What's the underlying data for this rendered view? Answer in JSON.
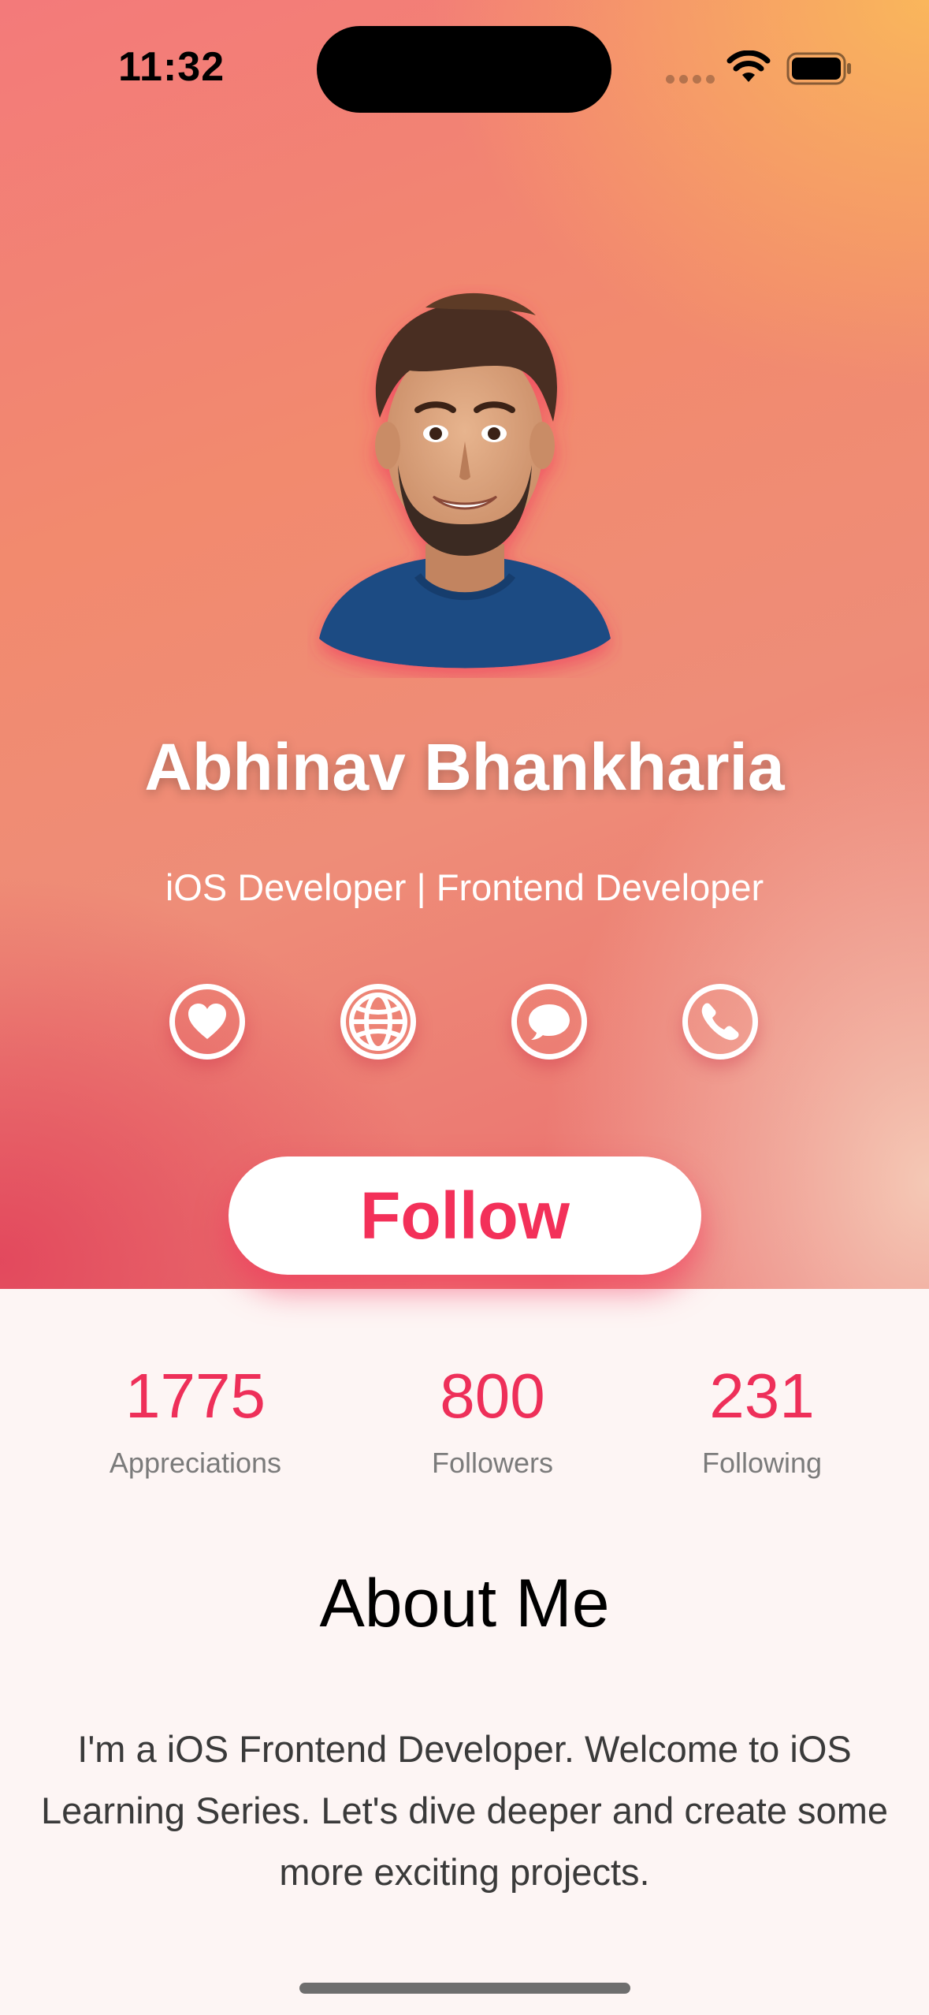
{
  "status_bar": {
    "time": "11:32"
  },
  "profile": {
    "name": "Abhinav Bhankharia",
    "title": "iOS Developer | Frontend Developer",
    "social_icons": [
      "heart-icon",
      "globe-icon",
      "message-icon",
      "phone-icon"
    ]
  },
  "follow_button": {
    "label": "Follow"
  },
  "stats": [
    {
      "value": "1775",
      "label": "Appreciations"
    },
    {
      "value": "800",
      "label": "Followers"
    },
    {
      "value": "231",
      "label": "Following"
    }
  ],
  "about": {
    "heading": "About Me",
    "text": "I'm a iOS Frontend Developer. Welcome to iOS Learning Series. Let's dive deeper and create some more exciting projects."
  },
  "colors": {
    "accent": "#f33059",
    "stat_value": "#ee2f59",
    "gradient_top_right": "#fab95a",
    "gradient_bottom_left": "#e2465c",
    "background": "#fdf5f4"
  }
}
